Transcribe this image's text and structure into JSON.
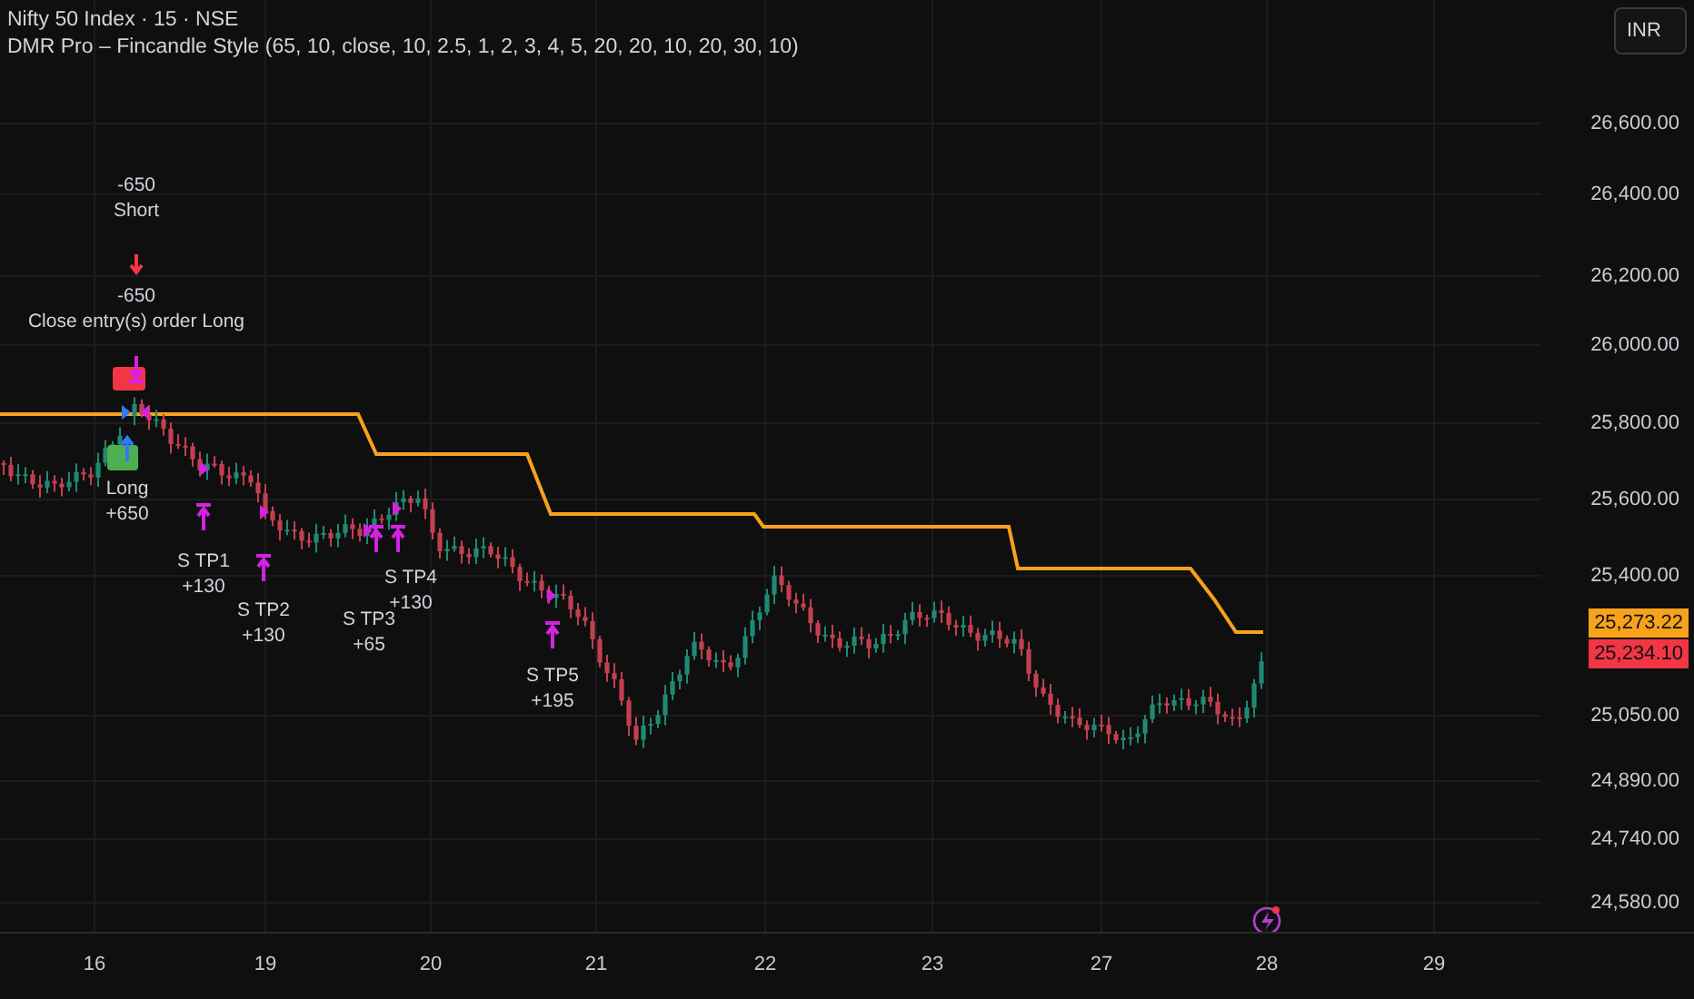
{
  "header": {
    "symbol": "Nifty 50 Index · 15 · NSE",
    "indicator": "DMR Pro – Fincandle Style (65, 10, close, 10, 2.5, 1, 2, 3, 4, 5, 20, 20, 10, 20, 30, 10)"
  },
  "currency": "INR",
  "price_ticks": [
    "26,600.00",
    "26,400.00",
    "26,200.00",
    "26,000.00",
    "25,800.00",
    "25,600.00",
    "25,400.00",
    "25,050.00",
    "24,890.00",
    "24,740.00",
    "24,580.00"
  ],
  "price_tags": [
    {
      "text": "25,273.22",
      "color": "#f7a21b"
    },
    {
      "text": "25,234.10",
      "color": "#f23645"
    }
  ],
  "date_ticks": [
    "16",
    "19",
    "20",
    "21",
    "22",
    "23",
    "27",
    "28",
    "29"
  ],
  "trade_labels": [
    {
      "kind": "short",
      "lines": [
        "-650",
        "Short"
      ]
    },
    {
      "kind": "close",
      "lines": [
        "-650",
        "Close entry(s) order Long"
      ]
    },
    {
      "kind": "long",
      "lines": [
        "Long",
        "+650"
      ]
    },
    {
      "kind": "tp",
      "lines": [
        "S TP1",
        "+130"
      ]
    },
    {
      "kind": "tp",
      "lines": [
        "S TP2",
        "+130"
      ]
    },
    {
      "kind": "tp",
      "lines": [
        "S TP3",
        "+65"
      ]
    },
    {
      "kind": "tp",
      "lines": [
        "S TP4",
        "+130"
      ]
    },
    {
      "kind": "tp",
      "lines": [
        "S TP5",
        "+195"
      ]
    }
  ]
}
